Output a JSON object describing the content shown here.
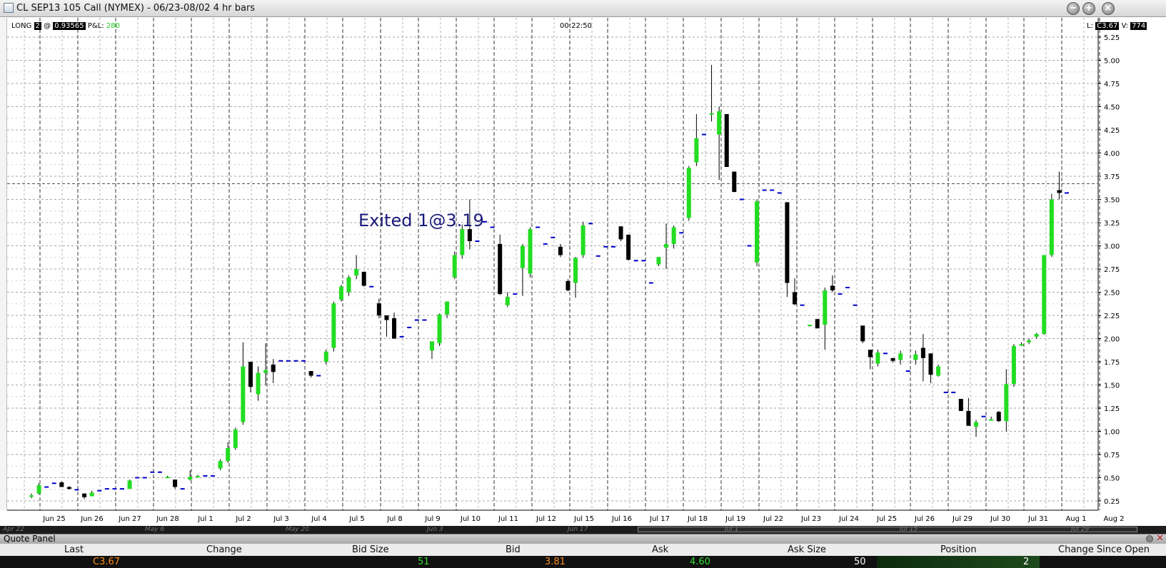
{
  "window": {
    "title": "CL SEP13 105 Call (NYMEX) - 06/23-08/02 4 hr bars",
    "controls": [
      "minimize",
      "maximize",
      "close"
    ]
  },
  "chart_header": {
    "position_label": "LONG",
    "position_qty": "2",
    "at_symbol": "@",
    "entry_price": "0.93565",
    "pnl_label": "P&L:",
    "pnl_value": "280",
    "clock": "00:22:50",
    "last_label": "L:",
    "last_value": "C3.67",
    "volume_label": "V:",
    "volume_value": "774"
  },
  "annotation": "Exited 1@3.19",
  "navigator": {
    "labels": [
      "Apr 22",
      "May 6",
      "May 20",
      "Jun 3",
      "Jun 17",
      "Jul 1",
      "Jul 15",
      "Jul 29"
    ]
  },
  "quote_panel": {
    "title": "Quote Panel",
    "headers": [
      "Last",
      "Change",
      "Bid Size",
      "Bid",
      "Ask",
      "Ask Size",
      "Position",
      "Change Since Open"
    ],
    "values": [
      "C3.67",
      "",
      "51",
      "3.81",
      "4.60",
      "50",
      "2",
      ""
    ],
    "value_colors": [
      "#ff8c1a",
      "#ffffff",
      "#33dd33",
      "#ff8c1a",
      "#33dd33",
      "#ffffff",
      "#ffffff",
      "#ffffff"
    ]
  },
  "colors": {
    "up_bar": "#22dd22",
    "down_bar": "#000000",
    "flat_tick": "#0000cc",
    "gridline": "#a6a6a6",
    "annotation": "#1a1a7a"
  },
  "chart_data": {
    "type": "candlestick",
    "title": "CL SEP13 105 Call (NYMEX) - 06/23-08/02 4 hr bars",
    "x_tick_labels": [
      "Jun 25",
      "Jun 26",
      "Jun 27",
      "Jun 28",
      "Jul 1",
      "Jul 2",
      "Jul 3",
      "Jul 4",
      "Jul 5",
      "Jul 8",
      "Jul 9",
      "Jul 10",
      "Jul 11",
      "Jul 12",
      "Jul 15",
      "Jul 16",
      "Jul 17",
      "Jul 18",
      "Jul 19",
      "Jul 22",
      "Jul 23",
      "Jul 24",
      "Jul 25",
      "Jul 26",
      "Jul 29",
      "Jul 30",
      "Jul 31",
      "Aug 1",
      "Aug 2"
    ],
    "y_ticks": [
      "0.25",
      "0.50",
      "0.75",
      "1.00",
      "1.25",
      "1.50",
      "1.75",
      "2.00",
      "2.25",
      "2.50",
      "2.75",
      "3.00",
      "3.25",
      "3.50",
      "3.75",
      "4.00",
      "4.25",
      "4.50",
      "4.75",
      "5.00",
      "5.25"
    ],
    "ylim": [
      0.15,
      5.35
    ],
    "grid": true,
    "last_price_line": 3.67,
    "bar_fields": [
      "open",
      "high",
      "low",
      "close"
    ],
    "bars": [
      [
        0.3,
        0.33,
        0.28,
        0.31
      ],
      [
        0.33,
        0.44,
        0.32,
        0.42
      ],
      [
        0.4,
        0.4,
        0.4,
        0.4
      ],
      [
        0.44,
        0.44,
        0.44,
        0.44
      ],
      [
        0.45,
        0.46,
        0.4,
        0.4
      ],
      [
        0.4,
        0.41,
        0.37,
        0.38
      ],
      [
        0.37,
        0.37,
        0.37,
        0.37
      ],
      [
        0.33,
        0.33,
        0.27,
        0.29
      ],
      [
        0.3,
        0.36,
        0.3,
        0.34
      ],
      [
        0.36,
        0.36,
        0.36,
        0.36
      ],
      [
        0.38,
        0.38,
        0.38,
        0.38
      ],
      [
        0.38,
        0.38,
        0.38,
        0.38
      ],
      [
        0.38,
        0.38,
        0.38,
        0.38
      ],
      [
        0.38,
        0.48,
        0.38,
        0.47
      ],
      [
        0.5,
        0.5,
        0.5,
        0.5
      ],
      [
        0.5,
        0.5,
        0.5,
        0.5
      ],
      [
        0.56,
        0.56,
        0.56,
        0.56
      ],
      [
        0.56,
        0.56,
        0.56,
        0.56
      ],
      [
        0.5,
        0.52,
        0.5,
        0.51
      ],
      [
        0.48,
        0.48,
        0.38,
        0.4
      ],
      [
        0.38,
        0.38,
        0.38,
        0.38
      ],
      [
        0.48,
        0.58,
        0.47,
        0.51
      ],
      [
        0.51,
        0.53,
        0.51,
        0.52
      ],
      [
        0.52,
        0.52,
        0.52,
        0.52
      ],
      [
        0.52,
        0.52,
        0.52,
        0.52
      ],
      [
        0.6,
        0.7,
        0.58,
        0.68
      ],
      [
        0.68,
        0.88,
        0.66,
        0.82
      ],
      [
        0.82,
        1.04,
        0.8,
        1.02
      ],
      [
        1.1,
        1.96,
        1.07,
        1.7
      ],
      [
        1.75,
        1.75,
        1.42,
        1.48
      ],
      [
        1.4,
        1.7,
        1.33,
        1.63
      ],
      [
        1.63,
        1.95,
        1.5,
        1.66
      ],
      [
        1.72,
        1.78,
        1.52,
        1.64
      ],
      [
        1.76,
        1.76,
        1.76,
        1.76
      ],
      [
        1.76,
        1.76,
        1.76,
        1.76
      ],
      [
        1.76,
        1.76,
        1.76,
        1.76
      ],
      [
        1.76,
        1.76,
        1.76,
        1.76
      ],
      [
        1.65,
        1.65,
        1.58,
        1.6
      ],
      [
        1.6,
        1.6,
        1.6,
        1.6
      ],
      [
        1.75,
        1.88,
        1.72,
        1.86
      ],
      [
        1.9,
        2.4,
        1.86,
        2.38
      ],
      [
        2.42,
        2.58,
        2.4,
        2.56
      ],
      [
        2.5,
        2.68,
        2.46,
        2.66
      ],
      [
        2.68,
        2.9,
        2.64,
        2.75
      ],
      [
        2.72,
        2.72,
        2.56,
        2.57
      ],
      [
        2.56,
        2.56,
        2.56,
        2.56
      ],
      [
        2.38,
        2.43,
        2.22,
        2.25
      ],
      [
        2.25,
        2.25,
        2.02,
        2.2
      ],
      [
        2.22,
        2.28,
        2.0,
        2.0
      ],
      [
        2.02,
        2.02,
        2.02,
        2.02
      ],
      [
        2.12,
        2.12,
        2.12,
        2.12
      ],
      [
        2.2,
        2.2,
        2.2,
        2.2
      ],
      [
        2.2,
        2.2,
        2.2,
        2.2
      ],
      [
        1.87,
        1.97,
        1.78,
        1.97
      ],
      [
        1.95,
        2.27,
        1.92,
        2.26
      ],
      [
        2.26,
        2.4,
        2.22,
        2.4
      ],
      [
        2.66,
        2.94,
        2.64,
        2.9
      ],
      [
        2.9,
        3.23,
        2.86,
        3.18
      ],
      [
        3.18,
        3.5,
        2.96,
        3.05
      ],
      [
        3.05,
        3.05,
        3.05,
        3.05
      ],
      [
        3.26,
        3.26,
        3.26,
        3.26
      ],
      [
        3.2,
        3.2,
        3.2,
        3.2
      ],
      [
        3.02,
        3.12,
        2.47,
        2.48
      ],
      [
        2.36,
        2.5,
        2.34,
        2.45
      ],
      [
        2.48,
        2.48,
        2.48,
        2.48
      ],
      [
        2.76,
        3.02,
        2.46,
        3.0
      ],
      [
        2.7,
        3.2,
        2.66,
        3.18
      ],
      [
        3.2,
        3.2,
        3.2,
        3.2
      ],
      [
        3.02,
        3.02,
        3.02,
        3.02
      ],
      [
        3.09,
        3.09,
        3.09,
        3.09
      ],
      [
        2.99,
        3.02,
        2.88,
        2.9
      ],
      [
        2.62,
        2.64,
        2.51,
        2.52
      ],
      [
        2.6,
        2.88,
        2.44,
        2.87
      ],
      [
        2.9,
        3.26,
        2.87,
        3.22
      ],
      [
        3.24,
        3.24,
        3.24,
        3.24
      ],
      [
        2.89,
        2.89,
        2.89,
        2.89
      ],
      [
        2.99,
        2.99,
        2.99,
        2.99
      ],
      [
        2.99,
        2.99,
        2.99,
        2.99
      ],
      [
        3.21,
        3.21,
        3.05,
        3.07
      ],
      [
        3.12,
        3.12,
        2.84,
        2.85
      ],
      [
        2.84,
        2.84,
        2.84,
        2.84
      ],
      [
        2.84,
        2.84,
        2.84,
        2.84
      ],
      [
        2.6,
        2.6,
        2.6,
        2.6
      ],
      [
        2.8,
        2.88,
        2.78,
        2.88
      ],
      [
        2.98,
        3.24,
        2.75,
        3.02
      ],
      [
        3.02,
        3.22,
        2.97,
        3.2
      ],
      [
        3.14,
        3.14,
        3.14,
        3.14
      ],
      [
        3.3,
        3.86,
        3.27,
        3.84
      ],
      [
        3.9,
        4.42,
        3.86,
        4.16
      ],
      [
        4.2,
        4.2,
        4.2,
        4.2
      ],
      [
        4.42,
        4.95,
        4.34,
        4.43
      ],
      [
        4.2,
        4.5,
        3.71,
        4.45
      ],
      [
        4.42,
        4.42,
        3.85,
        3.85
      ],
      [
        3.8,
        3.8,
        3.58,
        3.58
      ],
      [
        3.5,
        3.5,
        3.5,
        3.5
      ],
      [
        3.0,
        3.0,
        3.0,
        3.0
      ],
      [
        2.82,
        3.5,
        2.78,
        3.48
      ],
      [
        3.6,
        3.6,
        3.6,
        3.6
      ],
      [
        3.6,
        3.6,
        3.6,
        3.6
      ],
      [
        3.57,
        3.57,
        3.57,
        3.57
      ],
      [
        3.47,
        3.47,
        2.45,
        2.6
      ],
      [
        2.5,
        2.65,
        2.36,
        2.37
      ],
      [
        2.36,
        2.36,
        2.36,
        2.36
      ],
      [
        2.15,
        2.15,
        2.13,
        2.15
      ],
      [
        2.21,
        2.21,
        2.11,
        2.11
      ],
      [
        2.15,
        2.55,
        1.88,
        2.52
      ],
      [
        2.57,
        2.68,
        2.5,
        2.52
      ],
      [
        2.48,
        2.48,
        2.48,
        2.48
      ],
      [
        2.55,
        2.55,
        2.55,
        2.55
      ],
      [
        2.36,
        2.36,
        2.36,
        2.36
      ],
      [
        2.14,
        2.14,
        1.95,
        1.97
      ],
      [
        1.88,
        1.88,
        1.67,
        1.8
      ],
      [
        1.73,
        1.88,
        1.7,
        1.85
      ],
      [
        1.84,
        1.84,
        1.84,
        1.84
      ],
      [
        1.79,
        1.79,
        1.74,
        1.76
      ],
      [
        1.77,
        1.87,
        1.72,
        1.84
      ],
      [
        1.65,
        1.65,
        1.65,
        1.65
      ],
      [
        1.77,
        1.87,
        1.72,
        1.83
      ],
      [
        1.9,
        2.05,
        1.54,
        1.79
      ],
      [
        1.84,
        1.84,
        1.52,
        1.61
      ],
      [
        1.6,
        1.72,
        1.59,
        1.7
      ],
      [
        1.42,
        1.42,
        1.42,
        1.42
      ],
      [
        1.42,
        1.42,
        1.42,
        1.42
      ],
      [
        1.35,
        1.35,
        1.22,
        1.22
      ],
      [
        1.22,
        1.36,
        1.06,
        1.06
      ],
      [
        1.05,
        1.12,
        0.94,
        1.1
      ],
      [
        1.16,
        1.16,
        1.16,
        1.16
      ],
      [
        1.13,
        1.16,
        1.12,
        1.13
      ],
      [
        1.21,
        1.22,
        1.1,
        1.11
      ],
      [
        1.11,
        1.67,
        1.0,
        1.51
      ],
      [
        1.51,
        1.94,
        1.48,
        1.92
      ],
      [
        1.93,
        1.96,
        1.92,
        1.94
      ],
      [
        1.96,
        2.0,
        1.94,
        1.98
      ],
      [
        2.02,
        2.06,
        2.0,
        2.05
      ],
      [
        2.05,
        2.9,
        2.04,
        2.9
      ],
      [
        2.9,
        3.56,
        2.88,
        3.5
      ],
      [
        3.6,
        3.8,
        3.5,
        3.57
      ],
      [
        3.57,
        3.57,
        3.57,
        3.57
      ]
    ]
  }
}
